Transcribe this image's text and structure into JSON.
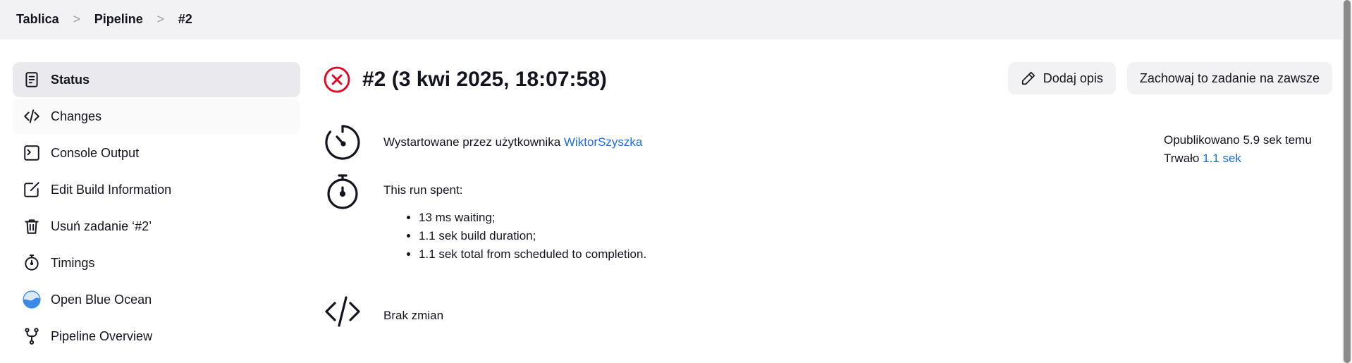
{
  "breadcrumb": {
    "items": [
      "Tablica",
      "Pipeline",
      "#2"
    ],
    "separator": ">"
  },
  "sidebar": {
    "items": [
      {
        "label": "Status",
        "icon": "document-icon",
        "active": true
      },
      {
        "label": "Changes",
        "icon": "code-icon"
      },
      {
        "label": "Console Output",
        "icon": "terminal-icon"
      },
      {
        "label": "Edit Build Information",
        "icon": "edit-icon"
      },
      {
        "label": "Usuń zadanie ‘#2’",
        "icon": "trash-icon"
      },
      {
        "label": "Timings",
        "icon": "stopwatch-icon"
      },
      {
        "label": "Open Blue Ocean",
        "icon": "blue-ocean-icon"
      },
      {
        "label": "Pipeline Overview",
        "icon": "pipeline-fork-icon"
      }
    ]
  },
  "build": {
    "title": "#2 (3 kwi 2025, 18:07:58)",
    "status_icon": "failed-x-icon",
    "status_color": "#e6001f"
  },
  "actions": {
    "add_description": "Dodaj opis",
    "keep_forever": "Zachowaj to zadanie na zawsze"
  },
  "meta": {
    "published": "Opublikowano 5.9 sek temu",
    "duration_prefix": "Trwało",
    "duration_value": "1.1 sek"
  },
  "cause": {
    "prefix": "Wystartowane przez użytkownika",
    "user": "WiktorSzyszka"
  },
  "timing": {
    "heading": "This run spent:",
    "items": [
      "13 ms waiting;",
      "1.1 sek build duration;",
      "1.1 sek total from scheduled to completion."
    ]
  },
  "changes": {
    "text": "Brak zmian"
  },
  "colors": {
    "link": "#1b6ee0",
    "topbar": "#f2f2f4",
    "active_item": "#eaeaee"
  }
}
